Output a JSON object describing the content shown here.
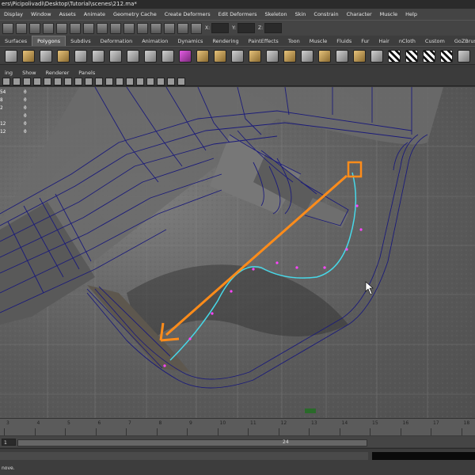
{
  "window": {
    "title": "ers\\Picipolivadi\\Desktop\\Tutorial\\scenes\\212.ma*"
  },
  "menu": [
    "Display",
    "Window",
    "Assets",
    "Animate",
    "Geometry Cache",
    "Create Deformers",
    "Edit Deformers",
    "Skeleton",
    "Skin",
    "Constrain",
    "Character",
    "Muscle",
    "Help"
  ],
  "statusline": {
    "x_label": "X:",
    "y_label": "Y:",
    "z_label": "Z:"
  },
  "shelf_tabs": [
    "Surfaces",
    "Polygons",
    "Subdivs",
    "Deformation",
    "Animation",
    "Dynamics",
    "Rendering",
    "PaintEffects",
    "Toon",
    "Muscle",
    "Fluids",
    "Fur",
    "Hair",
    "nCloth",
    "Custom",
    "GoZBrush"
  ],
  "active_shelf_tab": "Polygons",
  "panel_menu": [
    "ing",
    "Show",
    "Renderer",
    "Panels"
  ],
  "hud_stats": [
    {
      "label": "54",
      "value": "0"
    },
    {
      "label": "8",
      "value": "0"
    },
    {
      "label": "2",
      "value": "0"
    },
    {
      "label": "",
      "value": "0"
    },
    {
      "label": "12",
      "value": "0"
    },
    {
      "label": "12",
      "value": "0"
    }
  ],
  "timeline": {
    "ticks": [
      "3",
      "4",
      "5",
      "6",
      "7",
      "8",
      "9",
      "10",
      "11",
      "12",
      "13",
      "14",
      "15",
      "16",
      "17",
      "18"
    ]
  },
  "range": {
    "start": "1",
    "end": "24"
  },
  "helpline": {
    "text": "nove."
  },
  "colors": {
    "annotation": "#ff8c1a",
    "wireframe": "#1b1b7a",
    "curve": "#47d8e8",
    "cv_points": "#ff44ff"
  }
}
